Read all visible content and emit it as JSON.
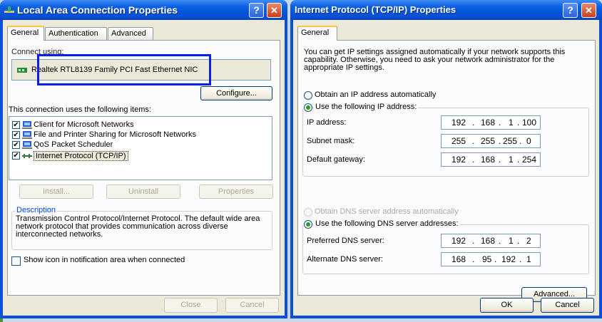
{
  "lac": {
    "title": "Local Area Connection Properties",
    "tabs": [
      "General",
      "Authentication",
      "Advanced"
    ],
    "connect_using_label": "Connect using:",
    "adapter": "Realtek RTL8139 Family PCI Fast Ethernet NIC",
    "configure_button": "Configure...",
    "items_label": "This connection uses the following items:",
    "items": [
      {
        "label": "Client for Microsoft Networks",
        "checked": true,
        "icon": "network-client-icon"
      },
      {
        "label": "File and Printer Sharing for Microsoft Networks",
        "checked": true,
        "icon": "file-printer-sharing-icon"
      },
      {
        "label": "QoS Packet Scheduler",
        "checked": true,
        "icon": "qos-scheduler-icon"
      },
      {
        "label": "Internet Protocol (TCP/IP)",
        "checked": true,
        "icon": "protocol-icon"
      }
    ],
    "install_button": "Install...",
    "uninstall_button": "Uninstall",
    "properties_button": "Properties",
    "description_title": "Description",
    "description_text": "Transmission Control Protocol/Internet Protocol. The default wide area network protocol that provides communication across diverse interconnected networks.",
    "show_icon_label": "Show icon in notification area when connected",
    "close_button": "Close",
    "cancel_button": "Cancel"
  },
  "tcpip": {
    "title": "Internet Protocol (TCP/IP) Properties",
    "tab": "General",
    "intro": "You can get IP settings assigned automatically if your network supports this capability. Otherwise, you need to ask your network administrator for the appropriate IP settings.",
    "obtain_ip_auto": "Obtain an IP address automatically",
    "use_following_ip": "Use the following IP address:",
    "ip_label": "IP address:",
    "ip_value": [
      "192",
      "168",
      "1",
      "100"
    ],
    "subnet_label": "Subnet mask:",
    "subnet_value": [
      "255",
      "255",
      "255",
      "0"
    ],
    "gateway_label": "Default gateway:",
    "gateway_value": [
      "192",
      "168",
      "1",
      "254"
    ],
    "obtain_dns_auto": "Obtain DNS server address automatically",
    "use_following_dns": "Use the following DNS server addresses:",
    "preferred_dns_label": "Preferred DNS server:",
    "preferred_dns_value": [
      "192",
      "168",
      "1",
      "2"
    ],
    "alternate_dns_label": "Alternate DNS server:",
    "alternate_dns_value": [
      "168",
      "95",
      "192",
      "1"
    ],
    "advanced_button": "Advanced...",
    "ok_button": "OK",
    "cancel_button": "Cancel"
  },
  "annotation": {
    "color": "#0a1ee6"
  },
  "icons": {
    "help": "?",
    "close": "✕",
    "check": "✔"
  }
}
